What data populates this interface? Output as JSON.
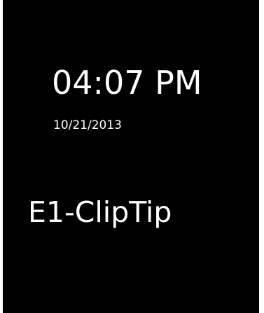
{
  "clock": {
    "time": "04:07 PM",
    "date": "10/21/2013"
  },
  "device": {
    "name": "E1-ClipTip"
  },
  "colors": {
    "background": "#000000",
    "text": "#ffffff"
  }
}
